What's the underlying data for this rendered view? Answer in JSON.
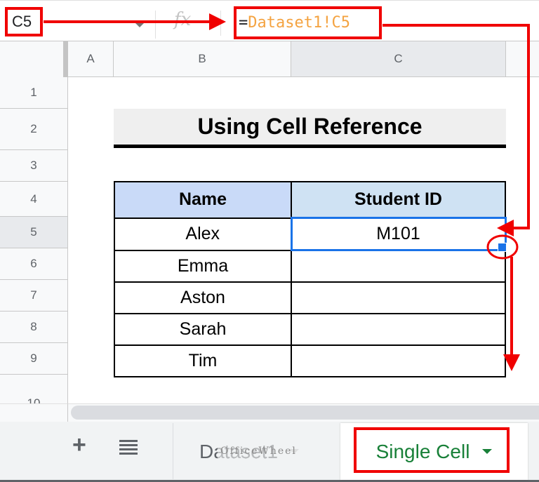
{
  "formula_bar": {
    "name_box": "C5",
    "fx_label": "fx",
    "formula_prefix": "=",
    "formula_ref": "Dataset1!C5"
  },
  "columns": [
    "A",
    "B",
    "C"
  ],
  "rows": [
    "1",
    "2",
    "3",
    "4",
    "5",
    "6",
    "7",
    "8",
    "9",
    "10"
  ],
  "selected": {
    "column": "C",
    "row": "5"
  },
  "sheet": {
    "title": "Using Cell Reference",
    "table": {
      "headers": [
        "Name",
        "Student ID"
      ],
      "rows": [
        [
          "Alex",
          "M101"
        ],
        [
          "Emma",
          ""
        ],
        [
          "Aston",
          ""
        ],
        [
          "Sarah",
          ""
        ],
        [
          "Tim",
          ""
        ]
      ]
    }
  },
  "tabs": {
    "add_label": "+",
    "items": [
      {
        "label": "Dataset1",
        "active": false
      },
      {
        "label": "Single Cell",
        "active": true
      }
    ]
  },
  "watermark": "OfficeWheel",
  "colors": {
    "annotation": "#f00000",
    "selection": "#1a73e8",
    "active_tab": "#188038",
    "formula_ref": "#f4a341"
  }
}
